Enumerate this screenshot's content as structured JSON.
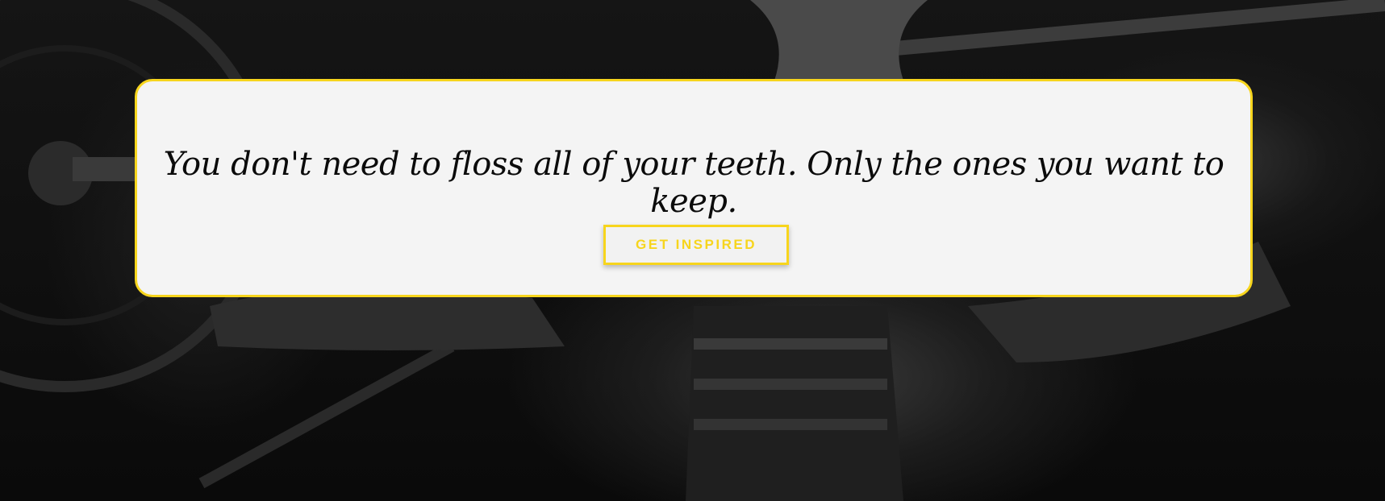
{
  "hero": {
    "background_image": "grayscale-gym-barbell-photo",
    "quote": "You don't need to floss all of your teeth. Only the ones you want to keep.",
    "cta_label": "GET INSPIRED"
  },
  "colors": {
    "accent": "#f7d51d",
    "card_background": "#f4f4f4",
    "quote_text": "#0b0b0b"
  }
}
